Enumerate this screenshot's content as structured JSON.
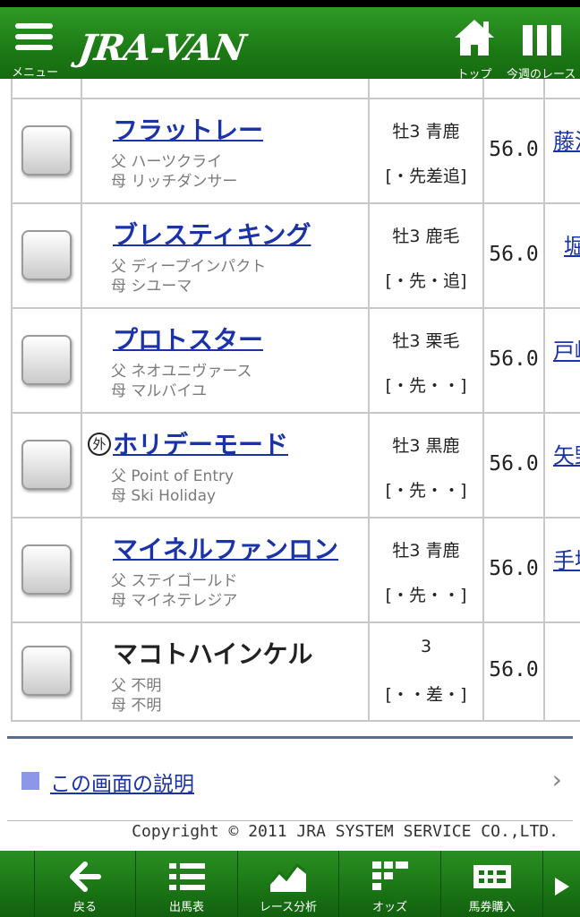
{
  "header": {
    "menu_label": "メニュー",
    "logo": "JRA-VAN",
    "top_label": "トップ",
    "week_label": "今週のレース"
  },
  "horses": [
    {
      "name": "フラットレー",
      "linked": true,
      "foreign": false,
      "sire": "父 ハーツクライ",
      "dam": "母 リッチダンサー",
      "sex_age_color": "牡3 青鹿",
      "running_style": "[・先差追]",
      "weight": "56.0",
      "jockey": "藤沢"
    },
    {
      "name": "ブレスティキング",
      "linked": true,
      "foreign": false,
      "sire": "父 ディープインパクト",
      "dam": "母 シユーマ",
      "sex_age_color": "牡3 鹿毛",
      "running_style": "[・先・追]",
      "weight": "56.0",
      "jockey": "堀"
    },
    {
      "name": "プロトスター",
      "linked": true,
      "foreign": false,
      "sire": "父 ネオユニヴァース",
      "dam": "母 マルバイユ",
      "sex_age_color": "牡3 栗毛",
      "running_style": "[・先・・]",
      "weight": "56.0",
      "jockey": "戸崎"
    },
    {
      "name": "ホリデーモード",
      "linked": true,
      "foreign": true,
      "foreign_mark": "外",
      "sire": "父 Point of Entry",
      "dam": "母 Ski Holiday",
      "sex_age_color": "牡3 黒鹿",
      "running_style": "[・先・・]",
      "weight": "56.0",
      "jockey": "矢野"
    },
    {
      "name": "マイネルファンロン",
      "linked": true,
      "foreign": false,
      "sire": "父 ステイゴールド",
      "dam": "母 マイネテレジア",
      "sex_age_color": "牡3 青鹿",
      "running_style": "[・先・・]",
      "weight": "56.0",
      "jockey": "手塚"
    },
    {
      "name": "マコトハインケル",
      "linked": false,
      "foreign": false,
      "sire": "父 不明",
      "dam": "母 不明",
      "sex_age_color": "3",
      "running_style": "[・・差・]",
      "weight": "56.0",
      "jockey": ""
    }
  ],
  "help": {
    "link_text": "この画面の説明",
    "chevron": "›"
  },
  "copyright": "Copyright © 2011 JRA SYSTEM SERVICE CO.,LTD.",
  "toolbar": {
    "back": "戻る",
    "entries": "出馬表",
    "analysis": "レース分析",
    "odds": "オッズ",
    "bet": "馬券購入"
  }
}
